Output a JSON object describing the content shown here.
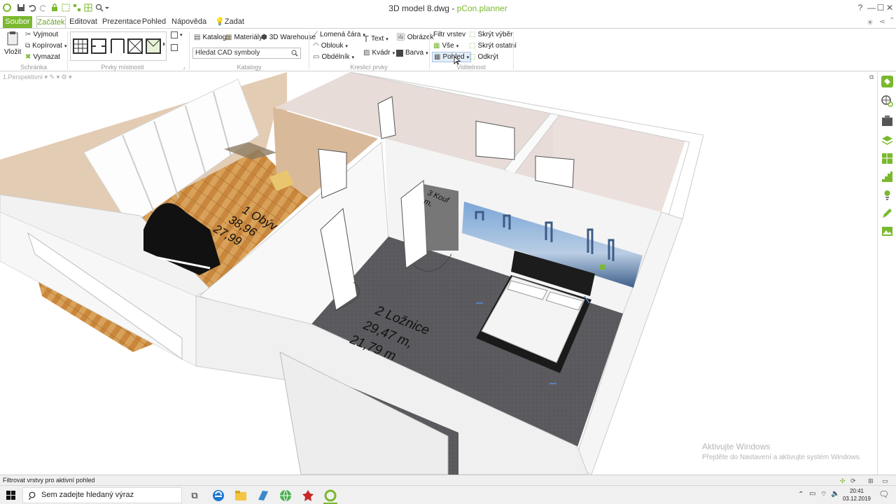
{
  "window": {
    "title_file": "3D model 8.dwg",
    "title_sep": " - ",
    "title_app": "pCon.planner"
  },
  "window_controls": {
    "help": "?",
    "minimize": "—",
    "maximize": "☐",
    "close": "✕"
  },
  "tabs": {
    "file": "Soubor",
    "home": "Začátek",
    "edit": "Editovat",
    "present": "Prezentace",
    "view": "Pohled",
    "help": "Nápověda",
    "command": "Zadat příkaz"
  },
  "ribbon": {
    "clipboard": {
      "paste": "Vložit",
      "cut": "Vyjmout",
      "copy": "Kopírovat",
      "delete": "Vymazat",
      "group": "Schránka"
    },
    "room_elements": {
      "group": "Prvky místnosti"
    },
    "catalogs": {
      "catalog": "Katalog",
      "materials": "Materiály",
      "warehouse": "3D Warehouse",
      "search_value": "Hledat CAD symboly",
      "group": "Katalogy"
    },
    "drawing": {
      "polyline": "Lomená čára",
      "arc": "Oblouk",
      "rectangle": "Obdélník",
      "text": "Text",
      "image": "Obrázek",
      "cube": "Kvádr",
      "color": "Barva",
      "group": "Kreslicí prvky"
    },
    "visibility": {
      "layer_filter": "Filtr vrstev",
      "all": "Vše",
      "view": "Pohled",
      "hide_selection": "Skrýt výběr",
      "hide_others": "Skrýt ostatní",
      "reveal": "Odkrýt",
      "group": "Viditelnost"
    }
  },
  "viewport": {
    "view_name": "1.Perspektivní",
    "room1": {
      "name": "1 Obýv",
      "area": "38,96",
      "perimeter": "27,99"
    },
    "room2": {
      "name": "2 Ložnice",
      "area": "29,47 m,",
      "perimeter": "21,79 m"
    },
    "room3_fragment": "3 Kouf\nm,"
  },
  "watermark": {
    "line1": "Aktivujte Windows",
    "line2": "Přejděte do Nastavení a aktivujte systém Windows."
  },
  "status": {
    "text": "Filtrovat vrstvy pro aktivní pohled"
  },
  "taskbar": {
    "search_placeholder": "Sem zadejte hledaný výraz",
    "time": "20:41",
    "date": "03.12.2019"
  },
  "colors": {
    "accent": "#7ab82e",
    "floor_dark": "#5a5a5e",
    "parquet": "#c9873d"
  }
}
